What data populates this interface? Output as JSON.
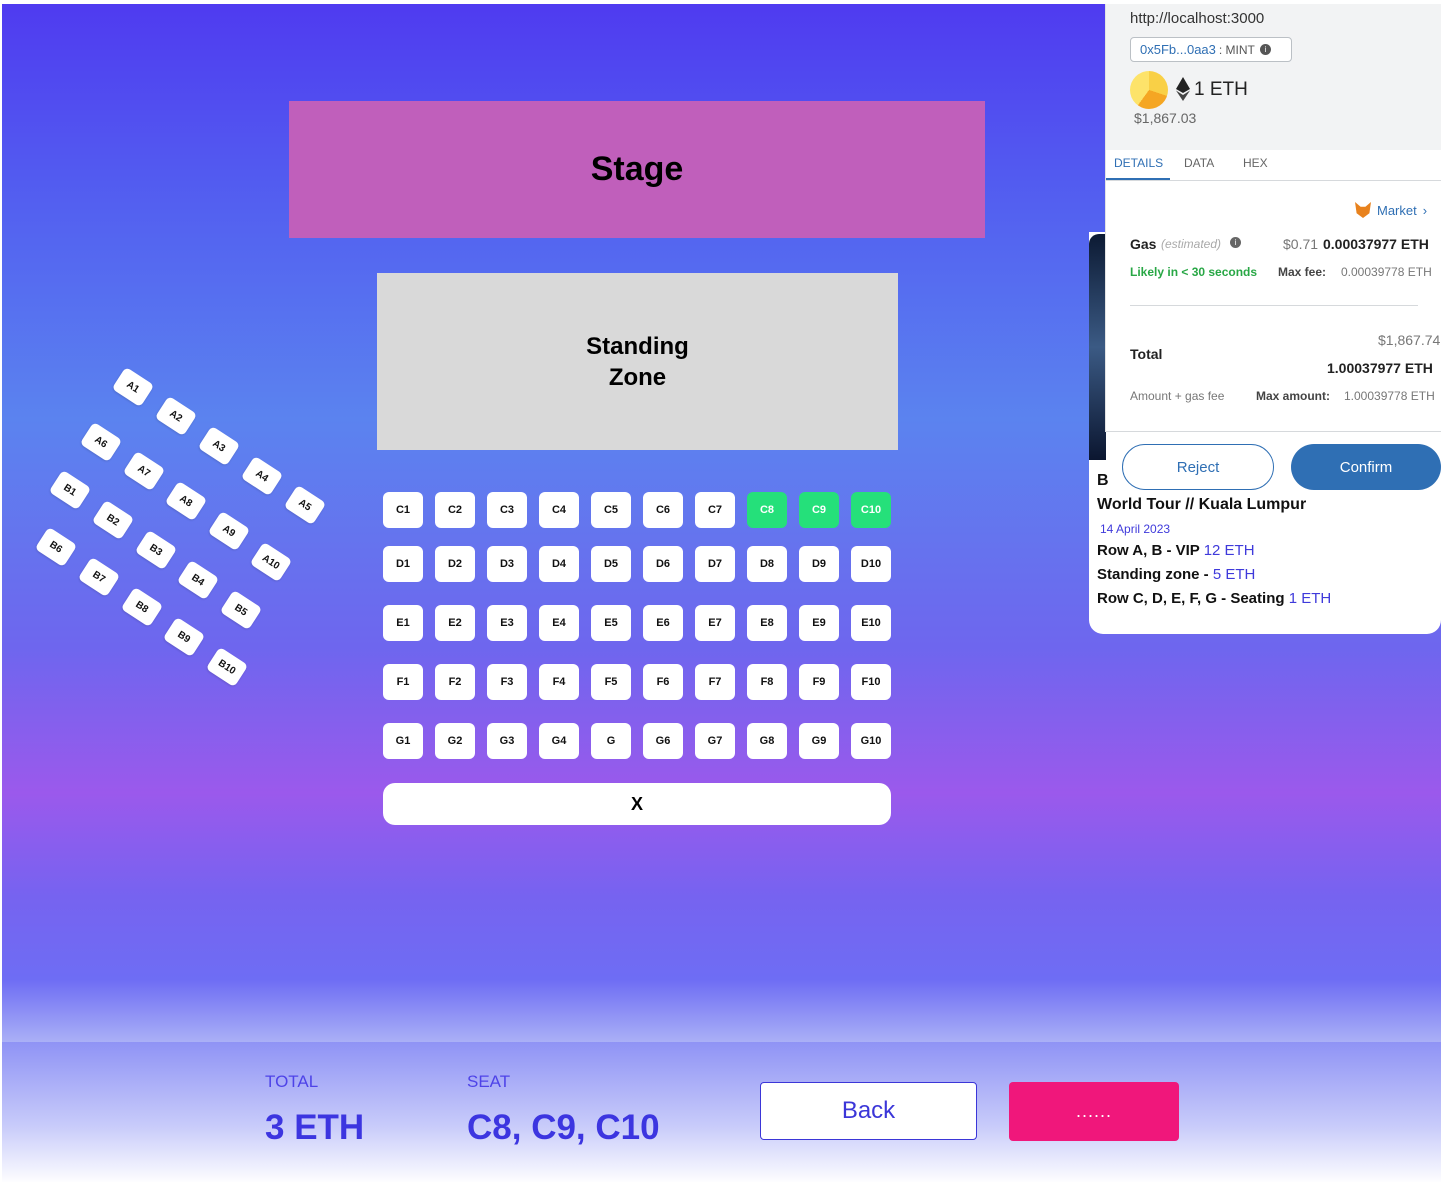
{
  "venue": {
    "stage_label": "Stage",
    "standing_label": "Standing Zone",
    "x_label": "X"
  },
  "rotated_seats": [
    "A1",
    "A2",
    "A3",
    "A4",
    "A5",
    "A6",
    "A7",
    "A8",
    "A9",
    "A10",
    "B1",
    "B2",
    "B3",
    "B4",
    "B5",
    "B6",
    "B7",
    "B8",
    "B9",
    "B10"
  ],
  "grid_rows": [
    [
      "C1",
      "C2",
      "C3",
      "C4",
      "C5",
      "C6",
      "C7",
      "C8",
      "C9",
      "C10"
    ],
    [
      "D1",
      "D2",
      "D3",
      "D4",
      "D5",
      "D6",
      "D7",
      "D8",
      "D9",
      "D10"
    ],
    [
      "E1",
      "E2",
      "E3",
      "E4",
      "E5",
      "E6",
      "E7",
      "E8",
      "E9",
      "E10"
    ],
    [
      "F1",
      "F2",
      "F3",
      "F4",
      "F5",
      "F6",
      "F7",
      "F8",
      "F9",
      "F10"
    ],
    [
      "G1",
      "G2",
      "G3",
      "G4",
      "G",
      "G6",
      "G7",
      "G8",
      "G9",
      "G10"
    ]
  ],
  "selected_seats": [
    "C8",
    "C9",
    "C10"
  ],
  "colors": {
    "selected": "#25e07a",
    "accent": "#3c35e0",
    "primary_button": "#f0177b"
  },
  "footer": {
    "total_label": "TOTAL",
    "total_value": "3 ETH",
    "seat_label": "SEAT",
    "seat_value": "C8, C9, C10",
    "back_label": "Back",
    "dots_label": "......"
  },
  "event_card": {
    "b_letter": "B",
    "title": "World Tour // Kuala Lumpur",
    "date": "14 April 2023",
    "lines": [
      {
        "text": "Row A, B - VIP ",
        "price": "12 ETH"
      },
      {
        "text": "Standing zone - ",
        "price": "5 ETH"
      },
      {
        "text": "Row C, D, E, F, G - Seating ",
        "price": "1 ETH"
      }
    ]
  },
  "metamask": {
    "url": "http://localhost:3000",
    "contract": "0x5Fb...0aa3",
    "method": ": MINT",
    "amount": "1 ETH",
    "fiat": "$1,867.03",
    "tabs": [
      "DETAILS",
      "DATA",
      "HEX"
    ],
    "market_label": "Market",
    "gas_label": "Gas",
    "gas_estimated": "(estimated)",
    "gas_fiat": "$0.71",
    "gas_eth": "0.00037977 ETH",
    "likely": "Likely in < 30 seconds",
    "max_fee_label": "Max fee:",
    "max_fee_value": "0.00039778 ETH",
    "total_label": "Total",
    "total_fiat": "$1,867.74",
    "total_eth": "1.00037977 ETH",
    "amount_gas_label": "Amount + gas fee",
    "max_amount_label": "Max amount:",
    "max_amount_value": "1.00039778 ETH",
    "reject_label": "Reject",
    "confirm_label": "Confirm"
  }
}
